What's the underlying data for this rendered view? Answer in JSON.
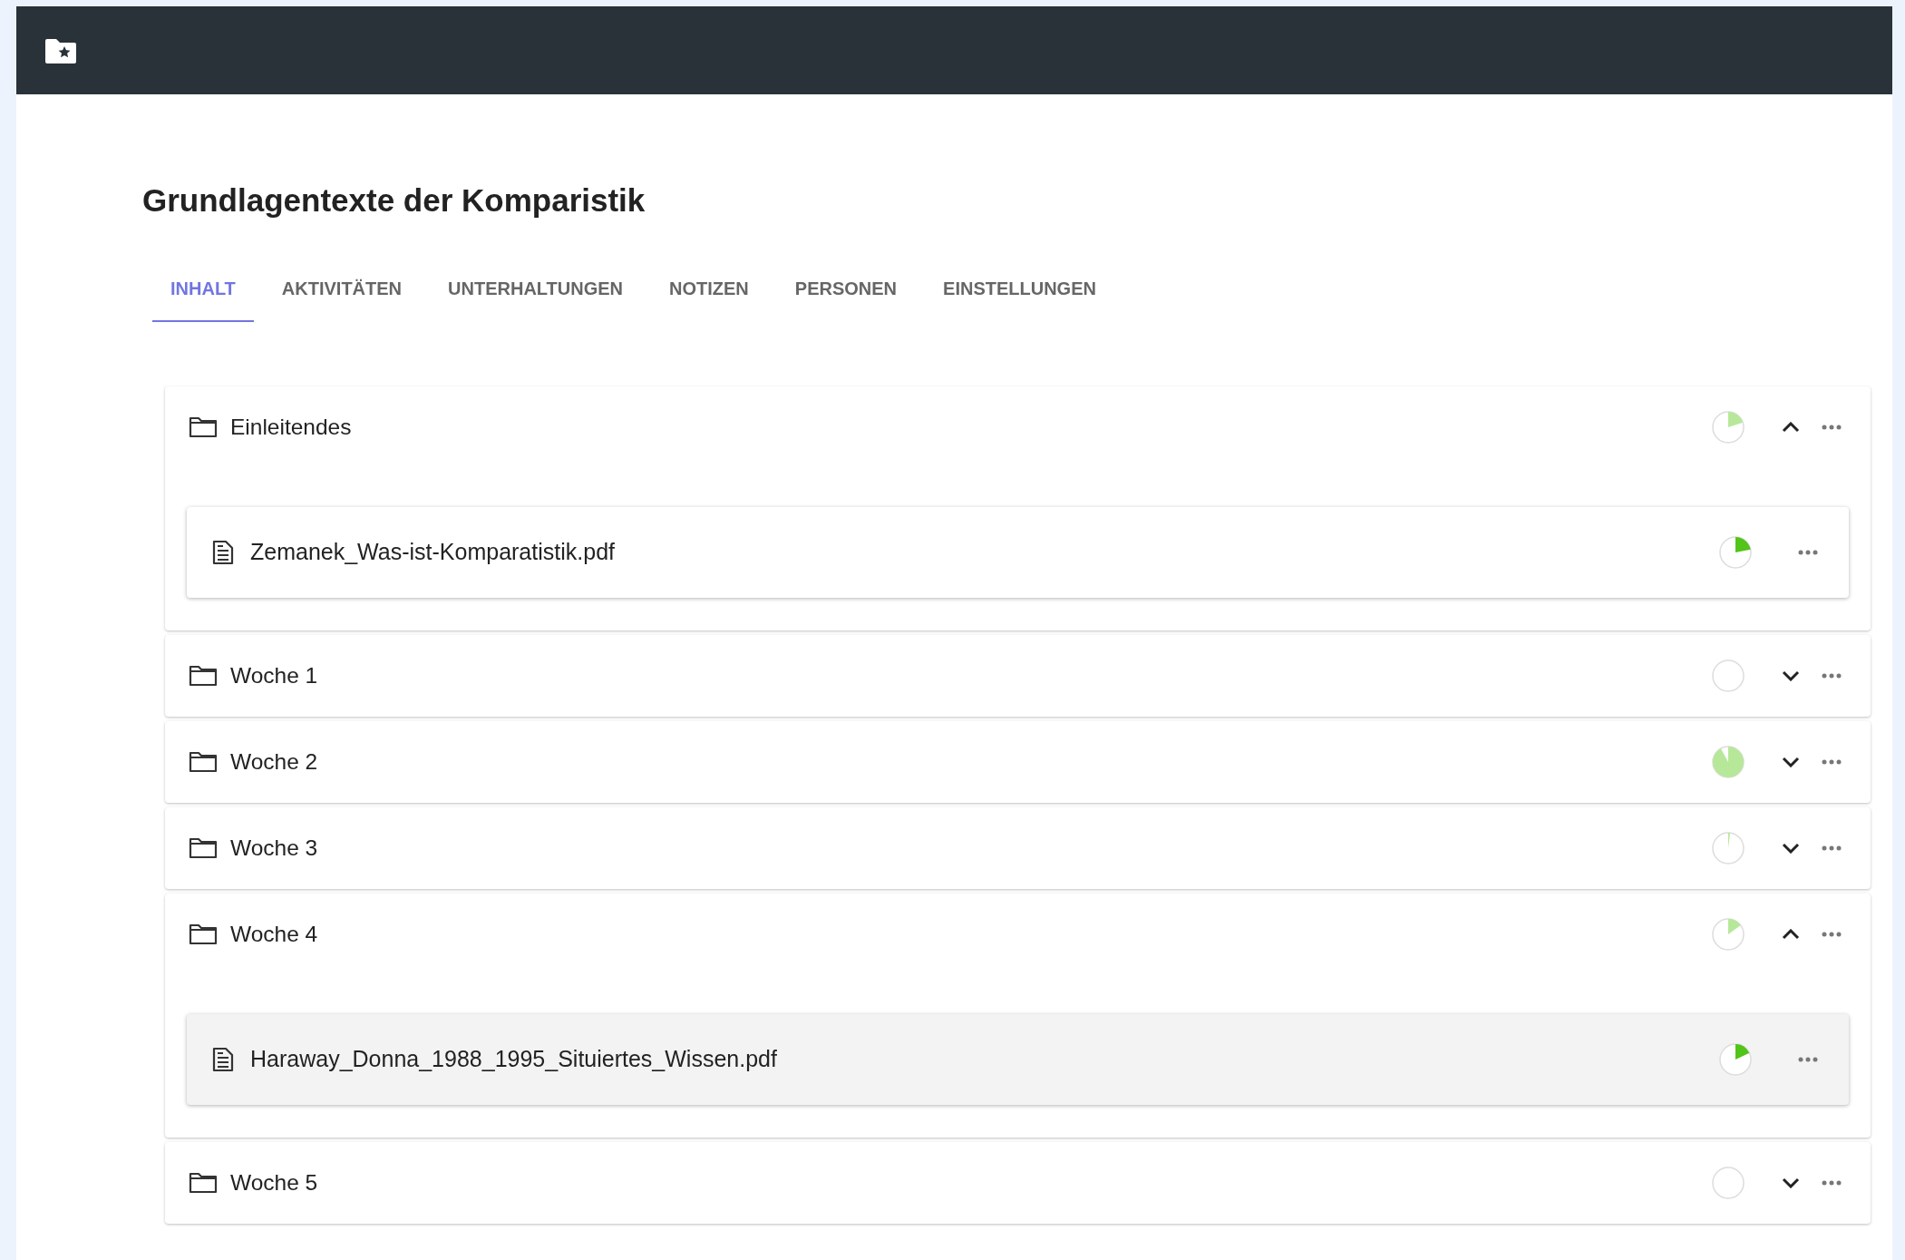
{
  "title": "Grundlagentexte der Komparistik",
  "tabs": [
    {
      "label": "INHALT",
      "selected": true
    },
    {
      "label": "AKTIVITÄTEN",
      "selected": false
    },
    {
      "label": "UNTERHALTUNGEN",
      "selected": false
    },
    {
      "label": "NOTIZEN",
      "selected": false
    },
    {
      "label": "PERSONEN",
      "selected": false
    },
    {
      "label": "EINSTELLUNGEN",
      "selected": false
    }
  ],
  "folders": [
    {
      "name": "Einleitendes",
      "expanded": true,
      "files": [
        {
          "name": "Zemanek_Was-ist-Komparatistik.pdf",
          "highlighted": false
        }
      ]
    },
    {
      "name": "Woche 1",
      "expanded": false
    },
    {
      "name": "Woche 2",
      "expanded": false
    },
    {
      "name": "Woche 3",
      "expanded": false
    },
    {
      "name": "Woche 4",
      "expanded": true,
      "files": [
        {
          "name": "Haraway_Donna_1988_1995_Situiertes_Wissen.pdf",
          "highlighted": true
        }
      ]
    },
    {
      "name": "Woche 5",
      "expanded": false
    }
  ]
}
